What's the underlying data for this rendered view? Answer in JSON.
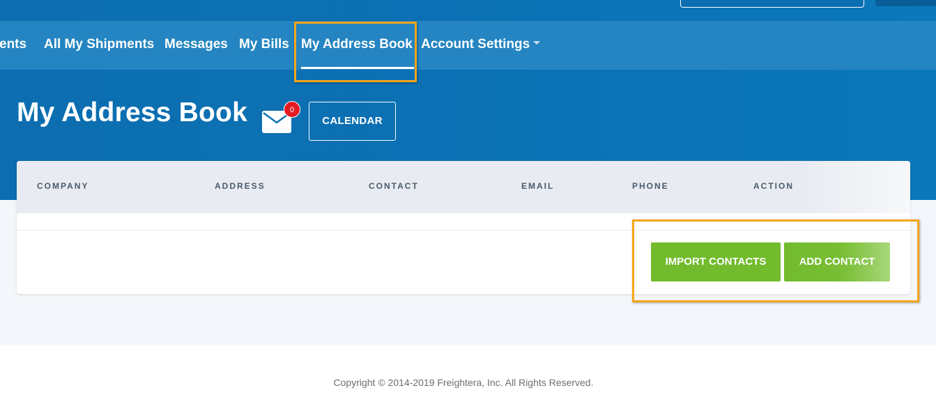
{
  "nav": {
    "items": [
      {
        "label": "ents"
      },
      {
        "label": "All My Shipments"
      },
      {
        "label": "Messages"
      },
      {
        "label": "My Bills"
      },
      {
        "label": "My Address Book"
      },
      {
        "label": "Account Settings"
      }
    ],
    "active": "My Address Book"
  },
  "page": {
    "title": "My Address Book",
    "mail_badge_count": "0",
    "calendar_label": "CALENDAR"
  },
  "table": {
    "columns": [
      "COMPANY",
      "ADDRESS",
      "CONTACT",
      "EMAIL",
      "PHONE",
      "ACTION"
    ],
    "rows": []
  },
  "actions": {
    "import_label": "IMPORT CONTACTS",
    "add_label": "ADD CONTACT"
  },
  "footer": {
    "copyright": "Copyright © 2014-2019 Freightera, Inc. All Rights Reserved."
  },
  "colors": {
    "brand_blue": "#0b72b5",
    "nav_blue": "#2485c2",
    "accent_green": "#72bb2d",
    "badge_red": "#e31b23",
    "highlight_orange": "#f5a51d"
  }
}
